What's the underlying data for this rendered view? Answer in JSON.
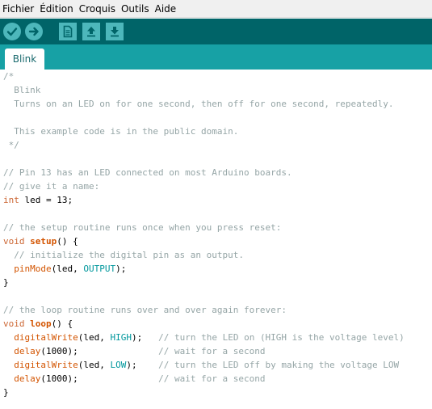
{
  "menu": [
    "Fichier",
    "Édition",
    "Croquis",
    "Outils",
    "Aide"
  ],
  "toolbar": {
    "buttons": [
      {
        "name": "verify-button",
        "icon": "checkmark-icon"
      },
      {
        "name": "upload-button",
        "icon": "arrow-right-icon"
      },
      {
        "name": "new-button",
        "icon": "document-icon"
      },
      {
        "name": "open-button",
        "icon": "arrow-up-icon"
      },
      {
        "name": "save-button",
        "icon": "arrow-down-icon"
      }
    ],
    "accent": "#006468",
    "button_color": "#4db7bb"
  },
  "tabs": [
    {
      "label": "Blink"
    }
  ],
  "code": {
    "l1": "/*",
    "l2": "  Blink",
    "l3": "  Turns on an LED on for one second, then off for one second, repeatedly.",
    "l5": "  This example code is in the public domain.",
    "l6": " */",
    "l8": "// Pin 13 has an LED connected on most Arduino boards.",
    "l9": "// give it a name:",
    "l10_type": "int",
    "l10_rest": " led = 13;",
    "l12": "// the setup routine runs once when you press reset:",
    "l13_type": "void",
    "l13_sp": " ",
    "l13_fn": "setup",
    "l13_rest": "() {",
    "l14": "  // initialize the digital pin as an output.",
    "l15_ind": "  ",
    "l15_fn": "pinMode",
    "l15_a": "(led, ",
    "l15_k": "OUTPUT",
    "l15_b": ");",
    "l16": "}",
    "l18": "// the loop routine runs over and over again forever:",
    "l19_type": "void",
    "l19_sp": " ",
    "l19_fn": "loop",
    "l19_rest": "() {",
    "l20_ind": "  ",
    "l20_fn": "digitalWrite",
    "l20_a": "(led, ",
    "l20_k": "HIGH",
    "l20_b": ");   ",
    "l20_c": "// turn the LED on (HIGH is the voltage level)",
    "l21_ind": "  ",
    "l21_fn": "delay",
    "l21_a": "(1000);               ",
    "l21_c": "// wait for a second",
    "l22_ind": "  ",
    "l22_fn": "digitalWrite",
    "l22_a": "(led, ",
    "l22_k": "LOW",
    "l22_b": ");    ",
    "l22_c": "// turn the LED off by making the voltage LOW",
    "l23_ind": "  ",
    "l23_fn": "delay",
    "l23_a": "(1000);               ",
    "l23_c": "// wait for a second",
    "l24": "}"
  }
}
